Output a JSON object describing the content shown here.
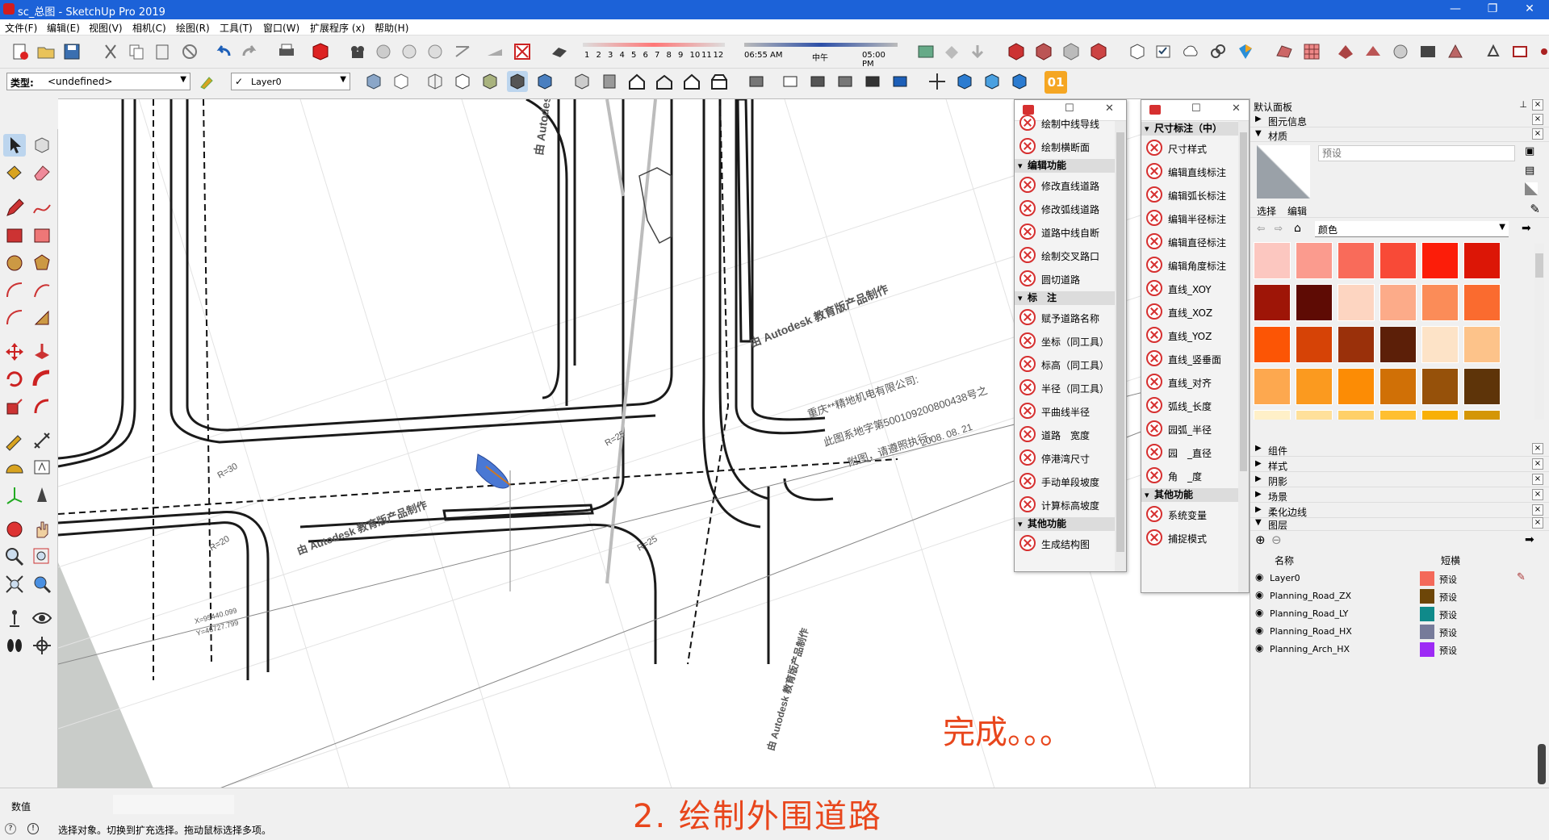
{
  "window": {
    "title": "sc_总图 - SketchUp Pro 2019",
    "controls": [
      "—",
      "❐",
      "✕"
    ]
  },
  "menu": [
    "文件(F)",
    "编辑(E)",
    "视图(V)",
    "相机(C)",
    "绘图(R)",
    "工具(T)",
    "窗口(W)",
    "扩展程序 (x)",
    "帮助(H)"
  ],
  "shadow_bar": {
    "months": [
      "1",
      "2",
      "3",
      "4",
      "5",
      "6",
      "7",
      "8",
      "9",
      "10",
      "11",
      "12"
    ],
    "time_start": "06:55 AM",
    "time_mid": "中午",
    "time_end": "05:00 PM"
  },
  "toolbar2": {
    "type_label": "类型:",
    "type_value": "<undefined>",
    "layer_value": "Layer0",
    "layer_check": "✓",
    "badge": "01"
  },
  "panel1": {
    "top_items": [
      "绘制中线导线",
      "绘制横断面"
    ],
    "sections": [
      {
        "title": "编辑功能",
        "items": [
          "修改直线道路",
          "修改弧线道路",
          "道路中线自断",
          "绘制交叉路口",
          "圆切道路"
        ]
      },
      {
        "title": "标　注",
        "items": [
          "赋予道路名称",
          "坐标（同工具）",
          "标高（同工具）",
          "半径（同工具）",
          "平曲线半径",
          "道路　宽度",
          "停港湾尺寸",
          "手动单段坡度",
          "计算标高坡度"
        ]
      },
      {
        "title": "其他功能",
        "items": [
          "生成结构图"
        ]
      }
    ]
  },
  "panel2": {
    "sections": [
      {
        "title": "尺寸标注（中）",
        "items": [
          "尺寸样式",
          "编辑直线标注",
          "编辑弧长标注",
          "编辑半径标注",
          "编辑直径标注",
          "编辑角度标注",
          "直线_XOY",
          "直线_XOZ",
          "直线_YOZ",
          "直线_竖垂面",
          "直线_对齐",
          "弧线_长度",
          "园弧_半径",
          "园　_直径",
          "角　_度"
        ]
      },
      {
        "title": "其他功能",
        "items": [
          "系统变量",
          "捕捉模式"
        ]
      }
    ]
  },
  "tray": {
    "title": "默认面板",
    "entity_info": "图元信息",
    "materials": "材质",
    "material_name_placeholder": "预设",
    "tabs": [
      "选择",
      "编辑"
    ],
    "library": "颜色",
    "swatches": [
      "#fcc7c0",
      "#fb9b8e",
      "#f96b5a",
      "#f84a37",
      "#fc1d09",
      "#dc1606",
      "#9e1507",
      "#5e0b04",
      "#fdd5c1",
      "#fcab89",
      "#fb8c58",
      "#fa6b2f",
      "#fc5505",
      "#d64306",
      "#9a300a",
      "#5c1f08",
      "#fde3c7",
      "#fdc38a",
      "#fda84f",
      "#fb9a1f",
      "#fc8c05",
      "#d07006",
      "#96510a",
      "#5e3409",
      "#fff0c8",
      "#ffe09a",
      "#ffd068",
      "#ffbf30",
      "#f8b006",
      "#d49606"
    ],
    "collapsed": [
      "组件",
      "样式",
      "阴影",
      "场景",
      "柔化边线"
    ],
    "layers_title": "图层",
    "layers_cols": [
      "名称",
      "短横"
    ],
    "layers": [
      {
        "name": "Layer0",
        "color": "#f4695a",
        "dash": "预设"
      },
      {
        "name": "Planning_Road_ZX",
        "color": "#6d4608",
        "dash": "预设"
      },
      {
        "name": "Planning_Road_LY",
        "color": "#0f8a8a",
        "dash": "预设"
      },
      {
        "name": "Planning_Road_HX",
        "color": "#767b9a",
        "dash": "预设"
      },
      {
        "name": "Planning_Arch_HX",
        "color": "#9d2af5",
        "dash": "预设"
      }
    ]
  },
  "drawing": {
    "watermarks": [
      "由 Autodesk 教育版产品制作",
      "由 Autodesk 教育版产品制作",
      "由 Autodesk 教育版产品制作",
      "由 Autodesk 教育版产品制作"
    ],
    "stamp_lines": [
      "重庆**精地机电有限公司:",
      "此图系地字第500109200800438号之",
      "附图，请遵照执行。"
    ],
    "stamp_date": "2008. 08. 21",
    "labels": [
      "R=30",
      "R=25",
      "R=20",
      "R=25",
      "X=95440.099",
      "Y=46727.799"
    ]
  },
  "overlay": {
    "done": "完成。。。",
    "caption": "2. 绘制外围道路"
  },
  "status": {
    "measure_label": "数值",
    "hint": "选择对象。切换到扩充选择。拖动鼠标选择多项。"
  }
}
